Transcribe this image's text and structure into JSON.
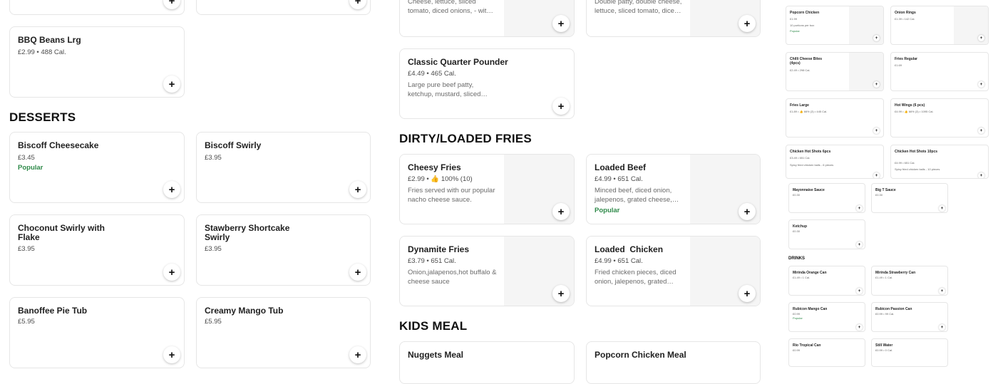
{
  "left_column": {
    "bbq": {
      "name": "BBQ Beans Lrg",
      "meta": "£2.99 • 488 Cal."
    },
    "desserts_heading": "DESSERTS",
    "desserts": [
      {
        "name": "Biscoff Cheesecake",
        "meta": "£3.45",
        "badge": "Popular"
      },
      {
        "name": "Biscoff Swirly",
        "meta": "£3.95"
      },
      {
        "name": "Choconut Swirly with Flake",
        "meta": "£3.95"
      },
      {
        "name": "Stawberry Shortcake Swirly",
        "meta": "£3.95"
      },
      {
        "name": "Banoffee Pie Tub",
        "meta": "£5.95"
      },
      {
        "name": "Creamy Mango Tub",
        "meta": "£5.95"
      }
    ]
  },
  "middle_column": {
    "top_partial": [
      {
        "desc": "Cheese, lettuce, sliced tomato, diced onions, - wit…"
      },
      {
        "desc": "Double patty, double cheese, lettuce, sliced tomato, dice…"
      }
    ],
    "quarter_pounder": {
      "name": "Classic Quarter Pounder",
      "meta": "£4.49 • 465 Cal.",
      "desc": "Large pure beef patty, ketchup, mustard, sliced…"
    },
    "fries_heading": "DIRTY/LOADED FRIES",
    "fries": [
      {
        "name": "Cheesy Fries",
        "meta": "£2.99 • 👍 100% (10)",
        "desc": "Fries served with our popular nacho cheese sauce."
      },
      {
        "name": "Loaded Beef",
        "meta": "£4.99 • 651 Cal.",
        "desc": "Minced beef, diced onion, jalepenos, grated cheese,…",
        "badge": "Popular"
      },
      {
        "name": "Dynamite Fries",
        "meta": "£3.79 • 651 Cal.",
        "desc": "Onion,jalapenos,hot buffalo & cheese sauce"
      },
      {
        "name": "Loaded  Chicken",
        "meta": "£4.99 • 651 Cal.",
        "desc": "Fried chicken pieces, diced onion, jalepenos, grated…"
      }
    ],
    "kids_heading": "KIDS MEAL",
    "kids": [
      {
        "name": "Nuggets Meal"
      },
      {
        "name": "Popcorn Chicken Meal"
      }
    ]
  },
  "preview": {
    "items": [
      {
        "name": "Popcorn Chicken",
        "meta": "£1.99",
        "extra": "10 portions per box",
        "badge": "Popular"
      },
      {
        "name": "Onion Rings",
        "meta": "£1.39 • 142 Cal."
      },
      {
        "name": "Chilli Cheese Bites (4pcs)",
        "meta": "£2.49 • 298 Cal."
      },
      {
        "name": "Fries Regular",
        "meta": "£1.69"
      },
      {
        "name": "Fries Large",
        "meta": "£1.89 • 👍 66% (3) • 445 Cal."
      },
      {
        "name": "Hot Wings (6 pcs)",
        "meta": "£4.99 • 👍 66% (3) • 1095 Cal."
      },
      {
        "name": "Chicken Hot Shots 6pcs",
        "meta": "£3.49 • 651 Cal.",
        "extra": "Spicy fried chicken balls - 6 pieces"
      },
      {
        "name": "Chicken Hot Shots 10pcs",
        "meta": "£4.99 • 651 Cal.",
        "extra": "Spicy fried chicken balls - 10 pieces"
      },
      {
        "name": "Mayonnaise Sauce",
        "meta": "£0.30"
      },
      {
        "name": "Big T Sauce",
        "meta": "£0.30"
      },
      {
        "name": "Ketchup",
        "meta": "£0.30"
      },
      {
        "name": "Mirinda Orange Can",
        "meta": "£1.49 • 1 Cal."
      },
      {
        "name": "Mirinda Strawberry Can",
        "meta": "£1.49 • 1 Cal."
      },
      {
        "name": "Rubicon Mango Can",
        "meta": "£0.99",
        "badge": "Popular"
      },
      {
        "name": "Rubicon Passion Can",
        "meta": "£0.99 • 99 Cal."
      },
      {
        "name": "Rio Tropical Can",
        "meta": "£0.99"
      },
      {
        "name": "Still Water",
        "meta": "£0.99 • 0 Cal."
      }
    ],
    "drinks_heading": "DRINKS"
  },
  "add_symbol": "+",
  "colors": {
    "popular": "#2f8a4a",
    "border": "#e6e6e6"
  }
}
